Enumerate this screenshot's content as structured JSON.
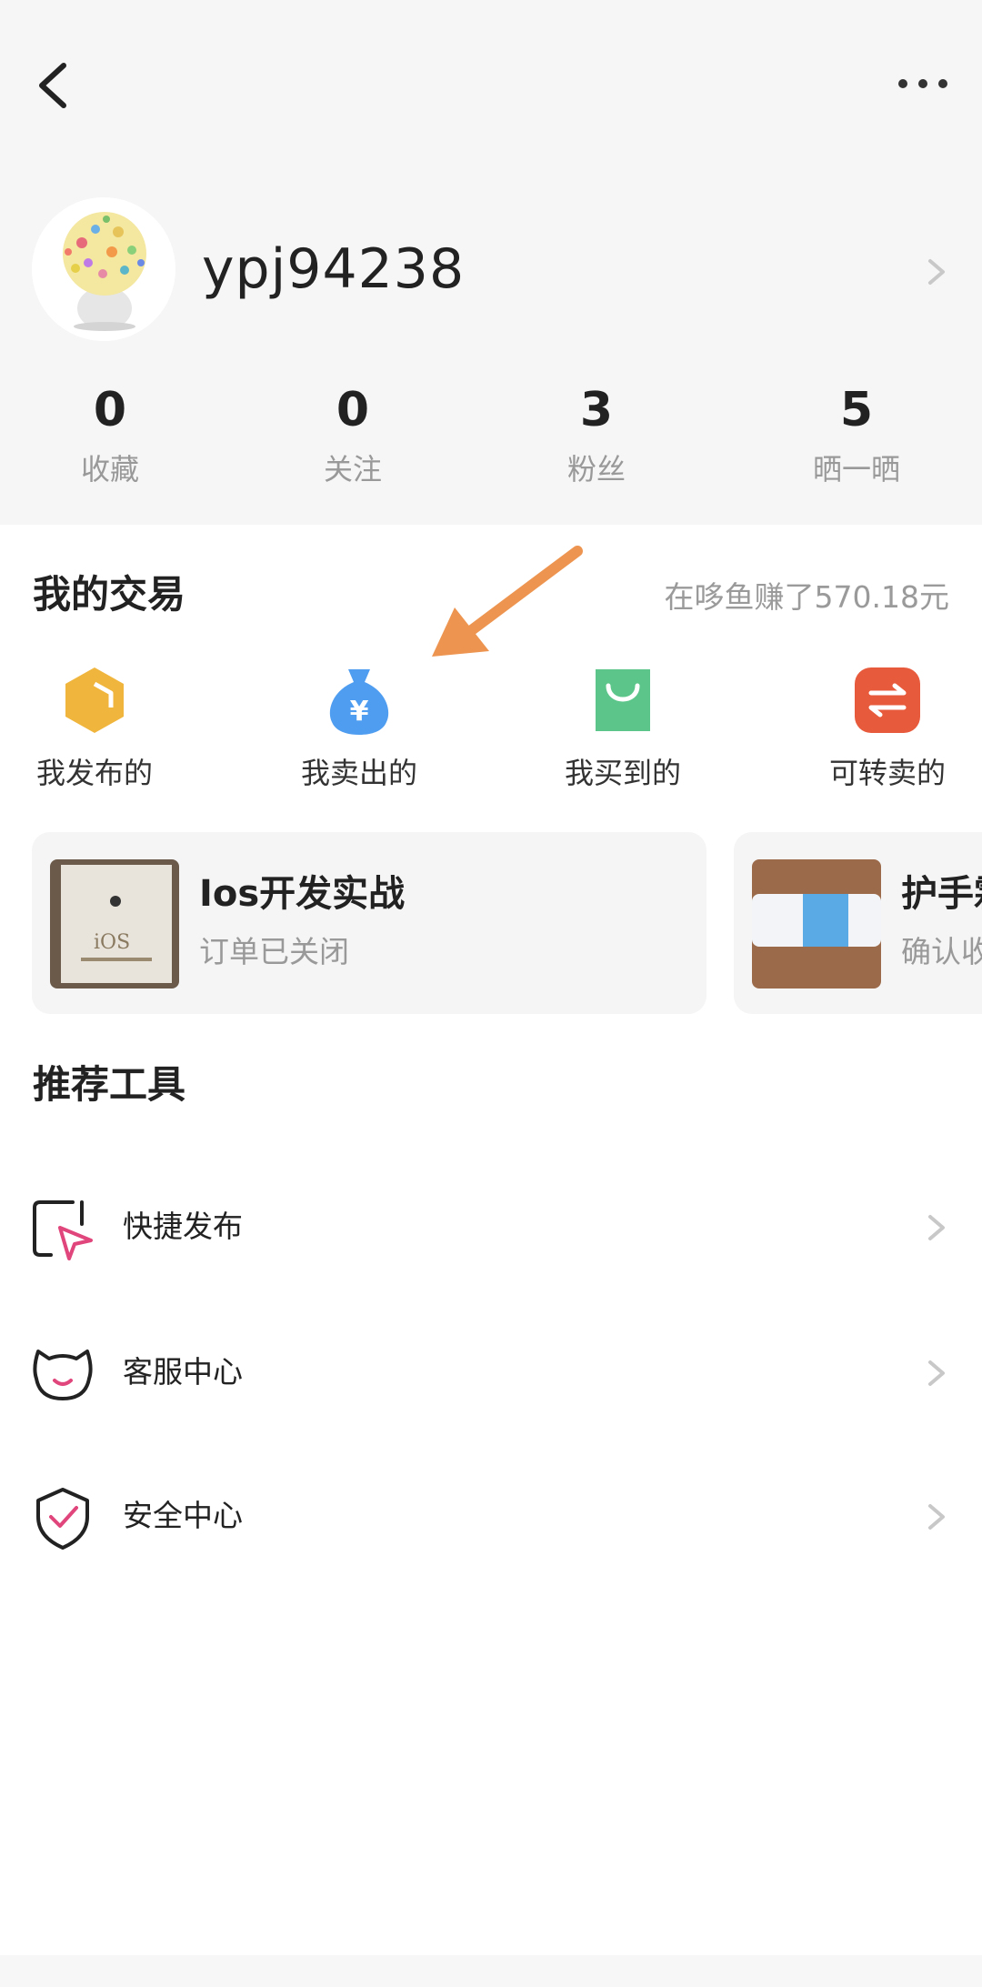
{
  "header": {
    "back_icon": "back-arrow-icon",
    "more_icon": "more-dots-icon"
  },
  "profile": {
    "username": "ypj94238",
    "avatar": "avatar"
  },
  "stats": [
    {
      "value": "0",
      "label": "收藏"
    },
    {
      "value": "0",
      "label": "关注"
    },
    {
      "value": "3",
      "label": "粉丝"
    },
    {
      "value": "5",
      "label": "晒一晒"
    }
  ],
  "trades": {
    "title": "我的交易",
    "earned": "在哆鱼赚了570.18元",
    "items": [
      {
        "label": "我发布的",
        "icon": "box-icon",
        "color": "#f0b53c"
      },
      {
        "label": "我卖出的",
        "icon": "money-bag-icon",
        "color": "#4f9df0"
      },
      {
        "label": "我买到的",
        "icon": "shopping-bag-icon",
        "color": "#5cc68a"
      },
      {
        "label": "可转卖的",
        "icon": "exchange-icon",
        "color": "#e85a3c"
      }
    ],
    "orders": [
      {
        "title": "Ios开发实战",
        "status": "订单已关闭"
      },
      {
        "title": "护手霜",
        "status": "确认收货"
      }
    ]
  },
  "tools": {
    "title": "推荐工具",
    "items": [
      {
        "label": "快捷发布",
        "icon": "quick-publish-icon"
      },
      {
        "label": "客服中心",
        "icon": "customer-service-icon"
      },
      {
        "label": "安全中心",
        "icon": "security-shield-icon"
      }
    ]
  },
  "colors": {
    "annotation_arrow": "#ed9550",
    "accent_pink": "#e0457b"
  }
}
